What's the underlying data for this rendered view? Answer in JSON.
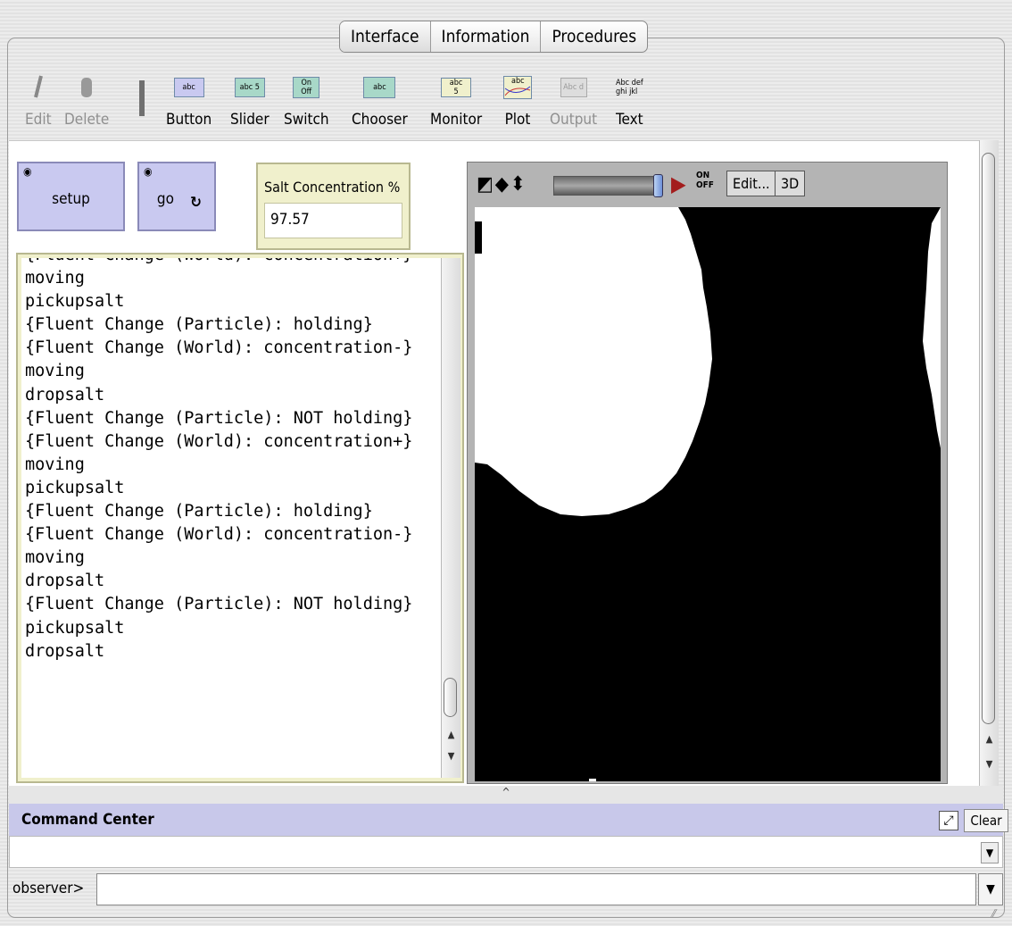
{
  "tabs": [
    "Interface",
    "Information",
    "Procedures"
  ],
  "toolbar": {
    "edit": "Edit",
    "delete": "Delete",
    "button": "Button",
    "slider": "Slider",
    "switch": "Switch",
    "chooser": "Chooser",
    "monitor": "Monitor",
    "plot": "Plot",
    "output": "Output",
    "text": "Text",
    "icon_button_text": "abc",
    "icon_slider_text": "abc 5",
    "icon_switch_on": "On",
    "icon_switch_off": "Off",
    "icon_chooser_text": "abc",
    "icon_monitor_text": "abc",
    "icon_monitor_value": "5",
    "icon_plot_text": "abc",
    "icon_output_text": "Abc d",
    "icon_text_line1": "Abc def",
    "icon_text_line2": "ghi jkl"
  },
  "widgets": {
    "setup_label": "setup",
    "go_label": "go",
    "monitor_label": "Salt Concentration %",
    "monitor_value": "97.57"
  },
  "output_lines": [
    "{Fluent Change (World): concentration+}",
    "moving",
    "pickupsalt",
    "{Fluent Change (Particle): holding}",
    "{Fluent Change (World): concentration-}",
    "moving",
    "dropsalt",
    "{Fluent Change (Particle): NOT holding}",
    "{Fluent Change (World): concentration+}",
    "moving",
    "pickupsalt",
    "{Fluent Change (Particle): holding}",
    "{Fluent Change (World): concentration-}",
    "moving",
    "dropsalt",
    "{Fluent Change (Particle): NOT holding}",
    "pickupsalt",
    "dropsalt"
  ],
  "view": {
    "edit_label": "Edit...",
    "threed_label": "3D",
    "on_label": "ON",
    "off_label": "OFF",
    "speed_fraction": 0.95
  },
  "command_center": {
    "title": "Command Center",
    "clear_label": "Clear",
    "prompt": "observer>",
    "input_value": ""
  },
  "colors": {
    "button_fill": "#c9c9f0",
    "monitor_fill": "#f0f0cc",
    "cc_header": "#c8c8ea",
    "world_background": "#000000",
    "world_patch": "#ffffff"
  }
}
